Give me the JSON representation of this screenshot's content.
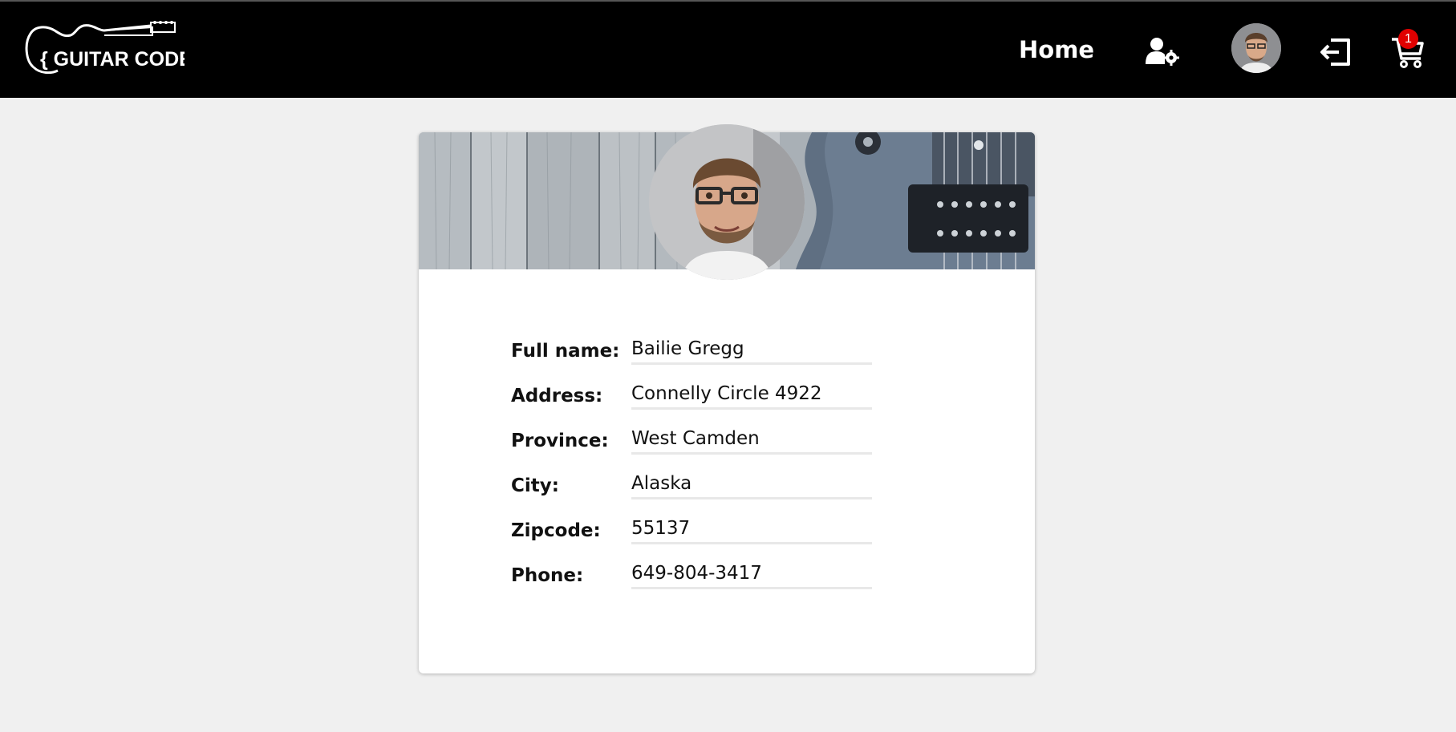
{
  "header": {
    "logo_text": "{ GUITAR CODE }",
    "nav": {
      "home_label": "Home"
    },
    "icons": {
      "settings": "user-gear-icon",
      "avatar": "avatar",
      "logout": "sign-out-icon",
      "cart": "shopping-cart-icon"
    },
    "cart_count": "1"
  },
  "profile": {
    "fields": [
      {
        "label": "Full name:",
        "value": "Bailie Gregg"
      },
      {
        "label": "Address:",
        "value": "Connelly Circle 4922"
      },
      {
        "label": "Province:",
        "value": "West Camden"
      },
      {
        "label": "City:",
        "value": "Alaska"
      },
      {
        "label": "Zipcode:",
        "value": "55137"
      },
      {
        "label": "Phone:",
        "value": "649-804-3417"
      }
    ]
  },
  "colors": {
    "header_bg": "#000000",
    "page_bg": "#f0f0f0",
    "card_bg": "#ffffff",
    "badge": "#e00000"
  }
}
